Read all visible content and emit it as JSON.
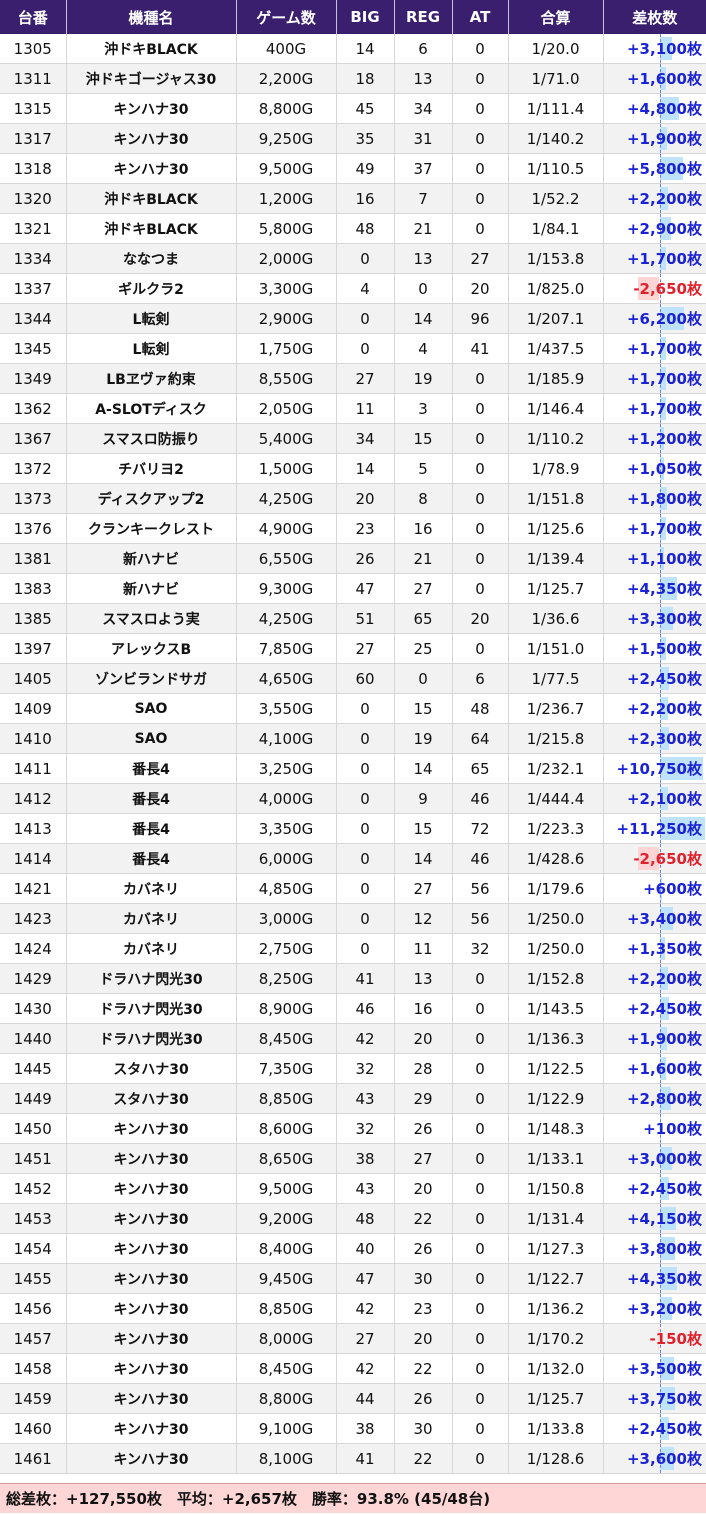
{
  "table": {
    "headers": [
      "台番",
      "機種名",
      "ゲーム数",
      "BIG",
      "REG",
      "AT",
      "合算",
      "差枚数"
    ],
    "rows": [
      [
        "1305",
        "沖ドキBLACK",
        "400G",
        "14",
        "6",
        "0",
        "1/20.0",
        "+3,100枚",
        3100
      ],
      [
        "1311",
        "沖ドキゴージャス30",
        "2,200G",
        "18",
        "13",
        "0",
        "1/71.0",
        "+1,600枚",
        1600
      ],
      [
        "1315",
        "キンハナ30",
        "8,800G",
        "45",
        "34",
        "0",
        "1/111.4",
        "+4,800枚",
        4800
      ],
      [
        "1317",
        "キンハナ30",
        "9,250G",
        "35",
        "31",
        "0",
        "1/140.2",
        "+1,900枚",
        1900
      ],
      [
        "1318",
        "キンハナ30",
        "9,500G",
        "49",
        "37",
        "0",
        "1/110.5",
        "+5,800枚",
        5800
      ],
      [
        "1320",
        "沖ドキBLACK",
        "1,200G",
        "16",
        "7",
        "0",
        "1/52.2",
        "+2,200枚",
        2200
      ],
      [
        "1321",
        "沖ドキBLACK",
        "5,800G",
        "48",
        "21",
        "0",
        "1/84.1",
        "+2,900枚",
        2900
      ],
      [
        "1334",
        "ななつま",
        "2,000G",
        "0",
        "13",
        "27",
        "1/153.8",
        "+1,700枚",
        1700
      ],
      [
        "1337",
        "ギルクラ2",
        "3,300G",
        "4",
        "0",
        "20",
        "1/825.0",
        "-2,650枚",
        -2650
      ],
      [
        "1344",
        "L転剣",
        "2,900G",
        "0",
        "14",
        "96",
        "1/207.1",
        "+6,200枚",
        6200
      ],
      [
        "1345",
        "L転剣",
        "1,750G",
        "0",
        "4",
        "41",
        "1/437.5",
        "+1,700枚",
        1700
      ],
      [
        "1349",
        "LBヱヴァ約束",
        "8,550G",
        "27",
        "19",
        "0",
        "1/185.9",
        "+1,700枚",
        1700
      ],
      [
        "1362",
        "A-SLOTディスク",
        "2,050G",
        "11",
        "3",
        "0",
        "1/146.4",
        "+1,700枚",
        1700
      ],
      [
        "1367",
        "スマスロ防振り",
        "5,400G",
        "34",
        "15",
        "0",
        "1/110.2",
        "+1,200枚",
        1200
      ],
      [
        "1372",
        "チバリヨ2",
        "1,500G",
        "14",
        "5",
        "0",
        "1/78.9",
        "+1,050枚",
        1050
      ],
      [
        "1373",
        "ディスクアップ2",
        "4,250G",
        "20",
        "8",
        "0",
        "1/151.8",
        "+1,800枚",
        1800
      ],
      [
        "1376",
        "クランキークレスト",
        "4,900G",
        "23",
        "16",
        "0",
        "1/125.6",
        "+1,700枚",
        1700
      ],
      [
        "1381",
        "新ハナビ",
        "6,550G",
        "26",
        "21",
        "0",
        "1/139.4",
        "+1,100枚",
        1100
      ],
      [
        "1383",
        "新ハナビ",
        "9,300G",
        "47",
        "27",
        "0",
        "1/125.7",
        "+4,350枚",
        4350
      ],
      [
        "1385",
        "スマスロよう実",
        "4,250G",
        "51",
        "65",
        "20",
        "1/36.6",
        "+3,300枚",
        3300
      ],
      [
        "1397",
        "アレックスB",
        "7,850G",
        "27",
        "25",
        "0",
        "1/151.0",
        "+1,500枚",
        1500
      ],
      [
        "1405",
        "ゾンビランドサガ",
        "4,650G",
        "60",
        "0",
        "6",
        "1/77.5",
        "+2,450枚",
        2450
      ],
      [
        "1409",
        "SAO",
        "3,550G",
        "0",
        "15",
        "48",
        "1/236.7",
        "+2,200枚",
        2200
      ],
      [
        "1410",
        "SAO",
        "4,100G",
        "0",
        "19",
        "64",
        "1/215.8",
        "+2,300枚",
        2300
      ],
      [
        "1411",
        "番長4",
        "3,250G",
        "0",
        "14",
        "65",
        "1/232.1",
        "+10,750枚",
        10750
      ],
      [
        "1412",
        "番長4",
        "4,000G",
        "0",
        "9",
        "46",
        "1/444.4",
        "+2,100枚",
        2100
      ],
      [
        "1413",
        "番長4",
        "3,350G",
        "0",
        "15",
        "72",
        "1/223.3",
        "+11,250枚",
        11250
      ],
      [
        "1414",
        "番長4",
        "6,000G",
        "0",
        "14",
        "46",
        "1/428.6",
        "-2,650枚",
        -2650
      ],
      [
        "1421",
        "カバネリ",
        "4,850G",
        "0",
        "27",
        "56",
        "1/179.6",
        "+600枚",
        600
      ],
      [
        "1423",
        "カバネリ",
        "3,000G",
        "0",
        "12",
        "56",
        "1/250.0",
        "+3,400枚",
        3400
      ],
      [
        "1424",
        "カバネリ",
        "2,750G",
        "0",
        "11",
        "32",
        "1/250.0",
        "+1,350枚",
        1350
      ],
      [
        "1429",
        "ドラハナ閃光30",
        "8,250G",
        "41",
        "13",
        "0",
        "1/152.8",
        "+2,200枚",
        2200
      ],
      [
        "1430",
        "ドラハナ閃光30",
        "8,900G",
        "46",
        "16",
        "0",
        "1/143.5",
        "+2,450枚",
        2450
      ],
      [
        "1440",
        "ドラハナ閃光30",
        "8,450G",
        "42",
        "20",
        "0",
        "1/136.3",
        "+1,900枚",
        1900
      ],
      [
        "1445",
        "スタハナ30",
        "7,350G",
        "32",
        "28",
        "0",
        "1/122.5",
        "+1,600枚",
        1600
      ],
      [
        "1449",
        "スタハナ30",
        "8,850G",
        "43",
        "29",
        "0",
        "1/122.9",
        "+2,800枚",
        2800
      ],
      [
        "1450",
        "キンハナ30",
        "8,600G",
        "32",
        "26",
        "0",
        "1/148.3",
        "+100枚",
        100
      ],
      [
        "1451",
        "キンハナ30",
        "8,650G",
        "38",
        "27",
        "0",
        "1/133.1",
        "+3,000枚",
        3000
      ],
      [
        "1452",
        "キンハナ30",
        "9,500G",
        "43",
        "20",
        "0",
        "1/150.8",
        "+2,450枚",
        2450
      ],
      [
        "1453",
        "キンハナ30",
        "9,200G",
        "48",
        "22",
        "0",
        "1/131.4",
        "+4,150枚",
        4150
      ],
      [
        "1454",
        "キンハナ30",
        "8,400G",
        "40",
        "26",
        "0",
        "1/127.3",
        "+3,800枚",
        3800
      ],
      [
        "1455",
        "キンハナ30",
        "9,450G",
        "47",
        "30",
        "0",
        "1/122.7",
        "+4,350枚",
        4350
      ],
      [
        "1456",
        "キンハナ30",
        "8,850G",
        "42",
        "23",
        "0",
        "1/136.2",
        "+3,200枚",
        3200
      ],
      [
        "1457",
        "キンハナ30",
        "8,000G",
        "27",
        "20",
        "0",
        "1/170.2",
        "-150枚",
        -150
      ],
      [
        "1458",
        "キンハナ30",
        "8,450G",
        "42",
        "22",
        "0",
        "1/132.0",
        "+3,500枚",
        3500
      ],
      [
        "1459",
        "キンハナ30",
        "8,800G",
        "44",
        "26",
        "0",
        "1/125.7",
        "+3,750枚",
        3750
      ],
      [
        "1460",
        "キンハナ30",
        "9,100G",
        "38",
        "30",
        "0",
        "1/133.8",
        "+2,450枚",
        2450
      ],
      [
        "1461",
        "キンハナ30",
        "8,100G",
        "41",
        "22",
        "0",
        "1/128.6",
        "+3,600枚",
        3600
      ]
    ]
  },
  "summary": "総差枚：+127,550枚　平均：+2,657枚　勝率：93.8% (45/48台)",
  "colors": {
    "header_bg": "#3a1f6e",
    "positive": "#1a22d6",
    "negative": "#e0202a",
    "bar_positive": "#bfe3fb",
    "bar_negative": "#ffd4d4",
    "summary_bg": "#ffd6d6"
  }
}
